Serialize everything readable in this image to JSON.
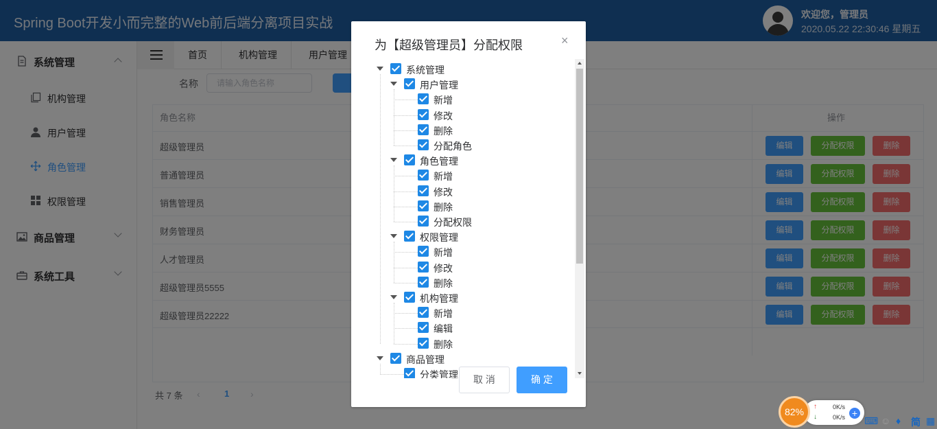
{
  "header": {
    "title": "Spring Boot开发小而完整的Web前后端分离项目实战",
    "welcome": "欢迎您，管理员",
    "datetime": "2020.05.22 22:30:46 星期五"
  },
  "sidebar": {
    "groups": [
      {
        "label": "系统管理",
        "icon": "document-icon"
      },
      {
        "label": "商品管理",
        "icon": "picture-icon"
      },
      {
        "label": "系统工具",
        "icon": "toolbox-icon"
      }
    ],
    "items": [
      {
        "label": "机构管理",
        "icon": "copy-icon"
      },
      {
        "label": "用户管理",
        "icon": "user-icon"
      },
      {
        "label": "角色管理",
        "icon": "move-icon"
      },
      {
        "label": "权限管理",
        "icon": "grid-icon"
      }
    ]
  },
  "tabs": [
    "首页",
    "机构管理",
    "用户管理"
  ],
  "search": {
    "label": "名称",
    "placeholder": "请输入角色名称"
  },
  "table": {
    "col_name": "角色名称",
    "col_ops": "操作",
    "rows": [
      "超级管理员",
      "普通管理员",
      "销售管理员",
      "财务管理员",
      "人才管理员",
      "超级管理员5555",
      "超级管理员22222"
    ],
    "edit_label": "编辑",
    "perm_label": "分配权限",
    "delete_label": "删除"
  },
  "pagination": {
    "total_text": "共 7 条",
    "prev": "‹",
    "current": "1",
    "next": "›"
  },
  "dialog": {
    "title": "为【超级管理员】分配权限",
    "close": "×",
    "cancel": "取 消",
    "confirm": "确 定",
    "tree": [
      {
        "label": "系统管理",
        "level": 0
      },
      {
        "label": "用户管理",
        "level": 1
      },
      {
        "label": "新增",
        "level": 2
      },
      {
        "label": "修改",
        "level": 2
      },
      {
        "label": "删除",
        "level": 2
      },
      {
        "label": "分配角色",
        "level": 2
      },
      {
        "label": "角色管理",
        "level": 1
      },
      {
        "label": "新增",
        "level": 2
      },
      {
        "label": "修改",
        "level": 2
      },
      {
        "label": "删除",
        "level": 2
      },
      {
        "label": "分配权限",
        "level": 2
      },
      {
        "label": "权限管理",
        "level": 1
      },
      {
        "label": "新增",
        "level": 2
      },
      {
        "label": "修改",
        "level": 2
      },
      {
        "label": "删除",
        "level": 2
      },
      {
        "label": "机构管理",
        "level": 1
      },
      {
        "label": "新增",
        "level": 2
      },
      {
        "label": "编辑",
        "level": 2
      },
      {
        "label": "删除",
        "level": 2
      },
      {
        "label": "商品管理",
        "level": 0
      },
      {
        "label": "分类管理",
        "level": 1
      }
    ]
  },
  "widget": {
    "percent": "82%",
    "up_speed": "0K/s",
    "down_speed": "0K/s",
    "ime": "简"
  },
  "colors": {
    "header": "#1f5fa3",
    "primary": "#409eff",
    "success": "#67c23a",
    "danger": "#f56c6c",
    "checkbox": "#1e88e5"
  }
}
